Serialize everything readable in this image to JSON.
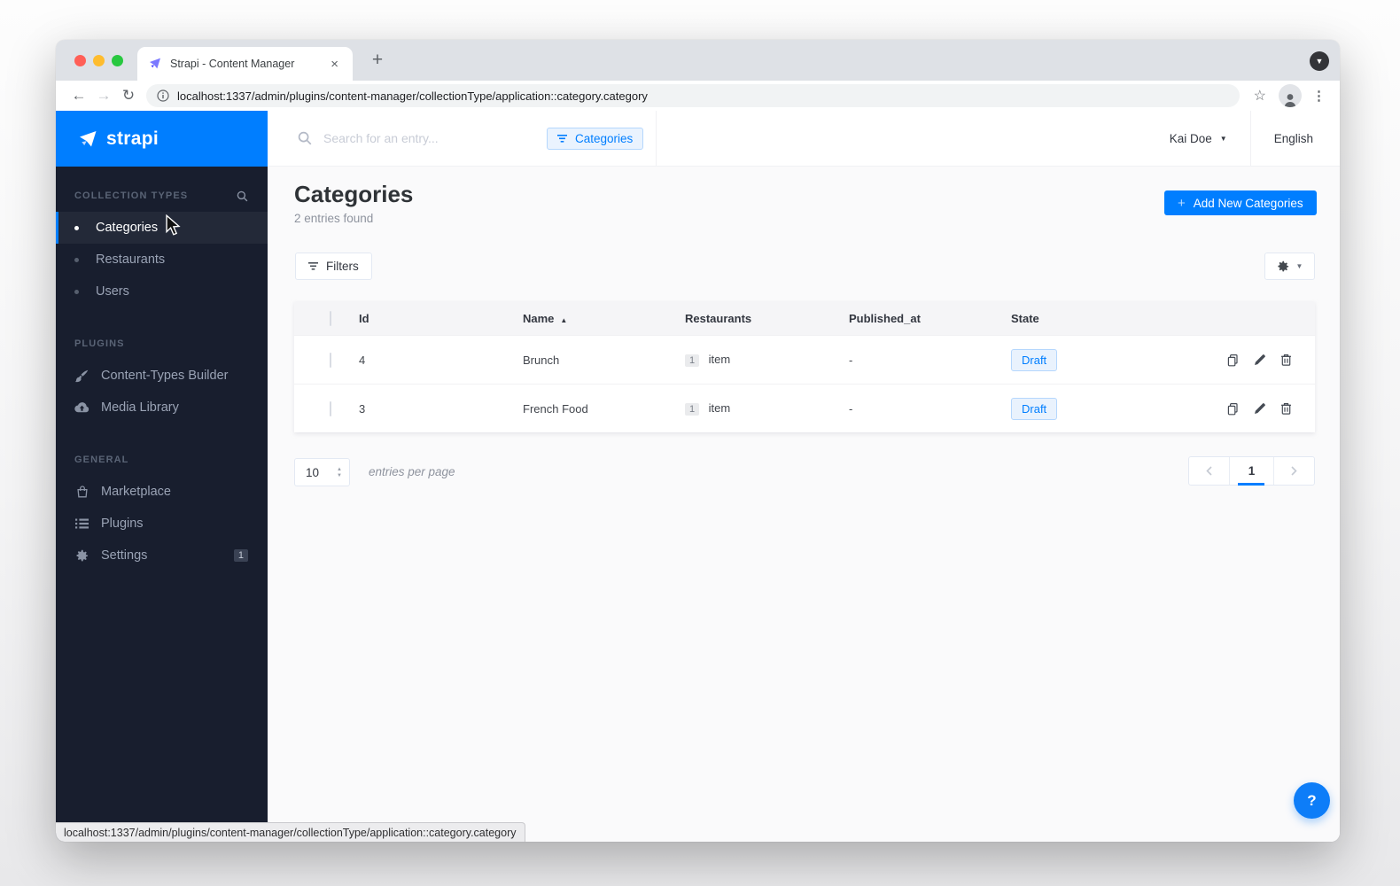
{
  "browser": {
    "tab_title": "Strapi - Content Manager",
    "url": "localhost:1337/admin/plugins/content-manager/collectionType/application::category.category"
  },
  "icons": {
    "back": "←",
    "forward": "→",
    "reload": "↻",
    "star": "☆",
    "menu_dots": "⋮",
    "tab_close": "×",
    "new_tab": "+",
    "tabs_chevron": "▼",
    "caret_down": "▼",
    "plus": "+",
    "sort_asc": "▲",
    "select_up": "▲",
    "select_down": "▼",
    "help": "?"
  },
  "sidebar": {
    "logo_text": "strapi",
    "sections": [
      {
        "header": "COLLECTION TYPES",
        "items": [
          {
            "label": "Categories"
          },
          {
            "label": "Restaurants"
          },
          {
            "label": "Users"
          }
        ]
      },
      {
        "header": "PLUGINS",
        "items": [
          {
            "label": "Content-Types Builder"
          },
          {
            "label": "Media Library"
          }
        ]
      },
      {
        "header": "GENERAL",
        "items": [
          {
            "label": "Marketplace"
          },
          {
            "label": "Plugins"
          },
          {
            "label": "Settings",
            "badge": "1"
          }
        ]
      }
    ]
  },
  "header": {
    "search_placeholder": "Search for an entry...",
    "filter_chip": "Categories",
    "user_name": "Kai Doe",
    "language": "English"
  },
  "page": {
    "title": "Categories",
    "subtitle": "2 entries found",
    "add_button_label": "Add New Categories",
    "filters_label": "Filters"
  },
  "table": {
    "columns": {
      "id": "Id",
      "name": "Name",
      "restaurants": "Restaurants",
      "published_at": "Published_at",
      "state": "State"
    },
    "rows": [
      {
        "id": "4",
        "name": "Brunch",
        "restaurants_count": "1",
        "restaurants_unit": "item",
        "published_at": "-",
        "state": "Draft"
      },
      {
        "id": "3",
        "name": "French Food",
        "restaurants_count": "1",
        "restaurants_unit": "item",
        "published_at": "-",
        "state": "Draft"
      }
    ]
  },
  "pagination": {
    "entries_per_page_value": "10",
    "entries_per_page_label": "entries per page",
    "current_page": "1"
  },
  "status_bar": {
    "url": "localhost:1337/admin/plugins/content-manager/collectionType/application::category.category"
  },
  "colors": {
    "brand_blue": "#007EFF",
    "sidebar_bg": "#181E2E",
    "draft_text": "#007EFF",
    "draft_bg": "#E9F2FD",
    "draft_border": "#B5D7FD"
  }
}
